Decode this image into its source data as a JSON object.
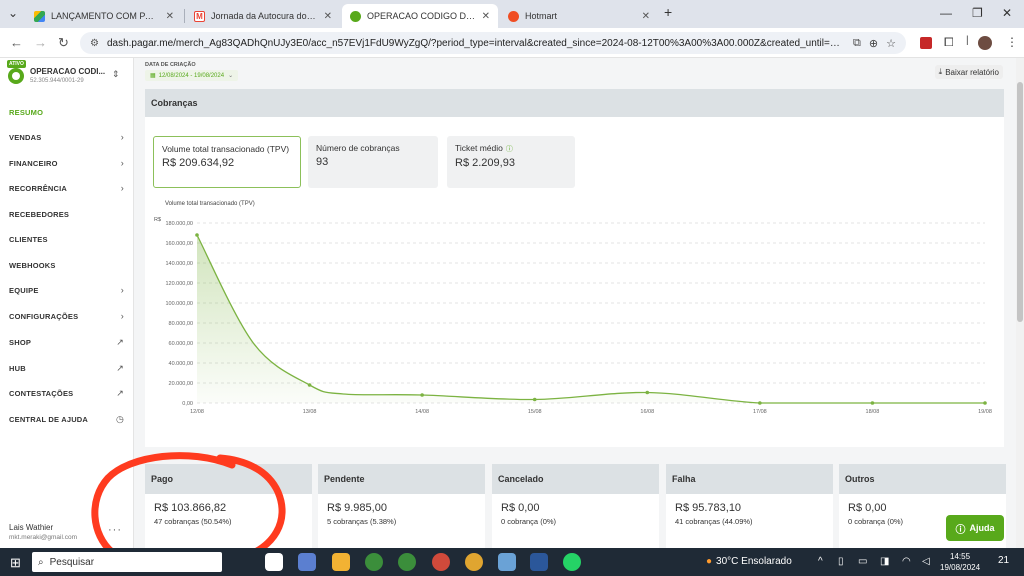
{
  "browser": {
    "tabs": [
      {
        "title": "LANÇAMENTO COM PARCERIA",
        "favicon": "drive-icon",
        "active": false
      },
      {
        "title": "Jornada da Autocura do Câncer",
        "favicon": "gmail-icon",
        "active": false
      },
      {
        "title": "OPERACAO CODIGO DE OURO",
        "favicon": "pagarme-icon",
        "active": true
      },
      {
        "title": "Hotmart",
        "favicon": "hotmart-icon",
        "active": false
      }
    ],
    "url": "dash.pagar.me/merch_Ag83QADhQnUJy3E0/acc_n57EVj1FdU9WyZgQ/?period_type=interval&created_since=2024-08-12T00%3A00%3A00.000Z&created_until=2024-08-19T23..."
  },
  "account": {
    "badge": "ATIVO",
    "name": "OPERACAO CODI...",
    "id": "52.305.944/0001-29"
  },
  "nav": [
    {
      "label": "RESUMO",
      "icon": "",
      "active": true
    },
    {
      "label": "VENDAS",
      "icon": "chevron-right-icon"
    },
    {
      "label": "FINANCEIRO",
      "icon": "chevron-right-icon"
    },
    {
      "label": "RECORRÊNCIA",
      "icon": "chevron-right-icon"
    },
    {
      "label": "RECEBEDORES",
      "icon": ""
    },
    {
      "label": "CLIENTES",
      "icon": ""
    },
    {
      "label": "WEBHOOKS",
      "icon": ""
    },
    {
      "label": "EQUIPE",
      "icon": "chevron-right-icon"
    },
    {
      "label": "CONFIGURAÇÕES",
      "icon": "chevron-right-icon"
    },
    {
      "label": "SHOP",
      "icon": "external-link-icon"
    },
    {
      "label": "HUB",
      "icon": "external-link-icon"
    },
    {
      "label": "CONTESTAÇÕES",
      "icon": "external-link-icon"
    },
    {
      "label": "CENTRAL DE AJUDA",
      "icon": "clock-icon"
    }
  ],
  "user": {
    "name": "Lais Wathier",
    "email": "mkt.meraki@gmail.com"
  },
  "filters": {
    "date_label": "DATA DE CRIAÇÃO",
    "date_range": "12/08/2024 - 19/08/2024",
    "download_label": "Baixar relatório"
  },
  "panel": {
    "title": "Cobranças",
    "kpis": [
      {
        "label": "Volume total transacionado (TPV)",
        "value": "R$ 209.634,92",
        "active": true
      },
      {
        "label": "Número de cobranças",
        "value": "93",
        "active": false
      },
      {
        "label": "Ticket médio",
        "value": "R$ 2.209,93",
        "active": false,
        "info": true
      }
    ]
  },
  "chart_data": {
    "type": "area",
    "title": "Volume total transacionado (TPV)",
    "ylabel": "R$",
    "ylim": [
      0,
      180000
    ],
    "yticks": [
      "0,00",
      "20.000,00",
      "40.000,00",
      "60.000,00",
      "80.000,00",
      "100.000,00",
      "120.000,00",
      "140.000,00",
      "160.000,00",
      "180.000,00"
    ],
    "categories": [
      "12/08",
      "13/08",
      "14/08",
      "15/08",
      "16/08",
      "17/08",
      "18/08",
      "19/08"
    ],
    "x_values": [
      0,
      1,
      2,
      3,
      4,
      5,
      6,
      7
    ],
    "series": [
      {
        "name": "Volume total transacionado (TPV)",
        "x": [
          0,
          0.5,
          1,
          1.3,
          2,
          3,
          4,
          5,
          6,
          7
        ],
        "values": [
          168000,
          60000,
          18000,
          9000,
          8000,
          3500,
          10500,
          0,
          0,
          0
        ],
        "color": "#7cb342"
      }
    ],
    "grid": true
  },
  "status_cards": [
    {
      "title": "Pago",
      "amount": "R$ 103.866,82",
      "count": "47 cobranças (50.54%)"
    },
    {
      "title": "Pendente",
      "amount": "R$ 9.985,00",
      "count": "5 cobranças (5.38%)"
    },
    {
      "title": "Cancelado",
      "amount": "R$ 0,00",
      "count": "0 cobrança (0%)"
    },
    {
      "title": "Falha",
      "amount": "R$ 95.783,10",
      "count": "41 cobranças (44.09%)"
    },
    {
      "title": "Outros",
      "amount": "R$ 0,00",
      "count": "0 cobrança (0%)"
    }
  ],
  "help_label": "Ajuda",
  "taskbar": {
    "search_placeholder": "Pesquisar",
    "weather": "30°C  Ensolarado",
    "time": "14:55",
    "date": "19/08/2024",
    "notifications": "21"
  },
  "colors": {
    "brand": "#58a91b",
    "chart_line": "#7cb342",
    "annotation": "#ff3b1f"
  }
}
